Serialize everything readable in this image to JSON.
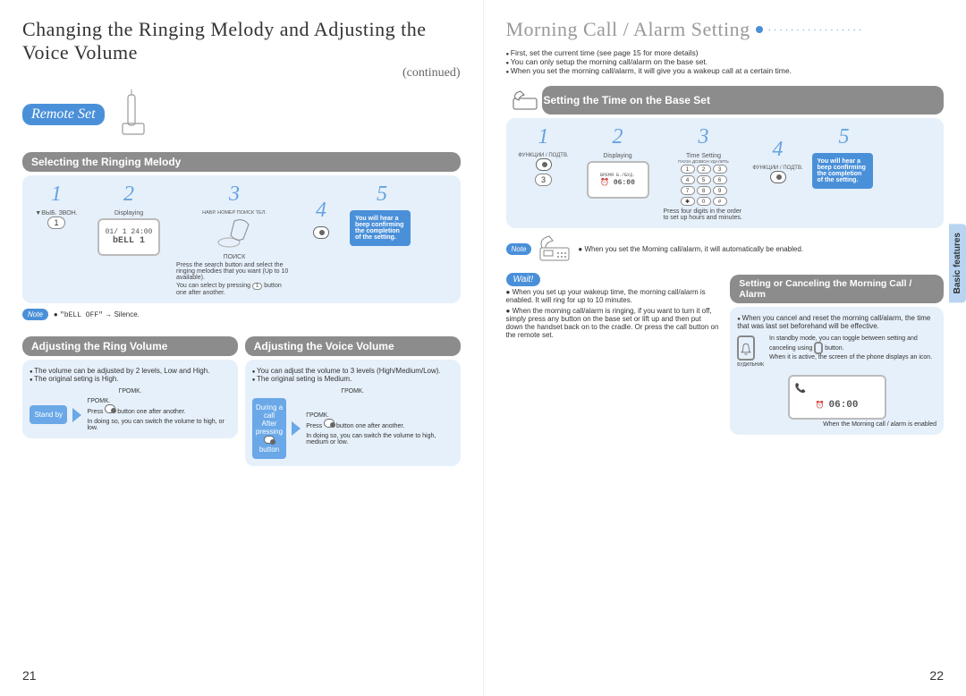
{
  "left": {
    "title": "Changing the Ringing Melody and Adjusting the Voice Volume",
    "continued": "(continued)",
    "remote_set": "Remote Set",
    "section_melody": "Selecting the Ringing Melody",
    "melody_steps": [
      "1",
      "2",
      "3",
      "4",
      "5"
    ],
    "melody_key1_label": "▼ВЫБ. ЗВОН.",
    "melody_key1_btn": "1",
    "melody_displaying": "Displaying",
    "melody_lcd_line1": "01/ 1   24:00",
    "melody_lcd_line2": "bELL   1",
    "melody_search_marks": "НАБР. НОМЕР           ПОИСК ТЕЛ.",
    "melody_poisk": "ПОИСК",
    "melody_step3_1": "Press the search button and select the ringing melodies that you want (Up to 10 available).",
    "melody_step3_2": "You can select by pressing",
    "melody_step3_2b": "button one after another.",
    "melody_step3_2_btn": "1",
    "melody_confirm": "You will hear a beep confirming the completion of the setting.",
    "note_text_pre": "\"bELL OFF\"",
    "note_text_post": "→ Silence.",
    "section_ring_vol": "Adjusting the Ring Volume",
    "ring_vol_b1": "The volume can be adjusted by 2 levels, Low and High.",
    "ring_vol_b2": "The original seting is High.",
    "standby": "Stand by",
    "ring_grom_top": "ГРОМК.",
    "ring_grom": "ГРОМК.",
    "ring_press": "Press",
    "ring_press_after": "button one after another.",
    "ring_indoing": "In doing so, you can switch the volume to high, or low.",
    "section_voice_vol": "Adjusting the Voice Volume",
    "voice_vol_b1": "You can adjust the volume to 3 levels (High/Medium/Low).",
    "voice_vol_b2": "The original seting is Medium.",
    "during": "During a call After pressing",
    "during_btn": "button",
    "voice_indoing": "In doing so, you can switch the volume to high, medium or low.",
    "pagenum": "21"
  },
  "right": {
    "title": "Morning Call / Alarm Setting",
    "intro1": "First, set the current time (see page 15 for more details)",
    "intro2": "You can only setup the morning call/alarm on the base set.",
    "intro3": "When you set the morning call/alarm, it will give you a wakeup call at a certain time.",
    "section_time": "Setting the Time on the Base Set",
    "time_steps": [
      "1",
      "2",
      "3",
      "4",
      "5"
    ],
    "time_key1_label": "ФУНКЦИИ / ПОДТВ.",
    "time_key1_btn": "3",
    "time_displaying": "Displaying",
    "time_lcd_marks": "ВРЕМЯ Б./БУД.",
    "time_lcd_time": "06:00",
    "time_setting_label": "Time Setting",
    "keypad": [
      "1",
      "2",
      "3",
      "4",
      "5",
      "6",
      "7",
      "8",
      "9",
      "✱",
      "0",
      "#"
    ],
    "keypad_labels_top": "ПАУЗА    ДОЗВОН    УДАЛИТЬ",
    "time_step3_note": "Press four digits in the order to set up hours and minutes.",
    "time_key4_label": "ФУНКЦИИ / ПОДТВ.",
    "time_confirm": "You will hear a beep confirming the completion of the setting.",
    "note_label": "Note",
    "note_main": "When you set the Morning call/alarm, it will automatically be enabled.",
    "wait_label": "Wait!",
    "wait_b1": "When you set up your wakeup time, the morning call/alarm is enabled. It will ring for up to 10 minutes.",
    "wait_b2": "When the morning call/alarm is ringing, if you want to turn it off, simply press any button on the base set or lift up and then put down the handset back on to the cradle. Or press the call button on the remote set.",
    "section_cancel": "Setting or Canceling the Morning Call / Alarm",
    "cancel_b1": "When you cancel and reset the morning call/alarm, the time that was last set beforehand will be effective.",
    "cancel_toggle1": "In standby mode, you can toggle between setting and canceling using",
    "cancel_toggle1b": "button.",
    "cancel_toggle2": "When it is active, the screen of the phone displays an icon.",
    "cancel_bell_label": "БУДИЛЬНИК",
    "cancel_lcd_time": "06:00",
    "cancel_caption": "When the Morning call / alarm is enabled",
    "side_tab": "Basic features",
    "pagenum": "22"
  }
}
